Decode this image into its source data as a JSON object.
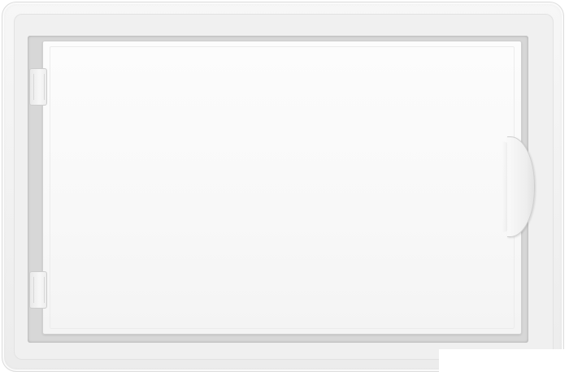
{
  "image": {
    "subject": "",
    "colors": {
      "frame": "#f1f1f1",
      "door": "#f8f8f8",
      "recess": "#d7d7d7",
      "background": "#ffffff"
    }
  }
}
